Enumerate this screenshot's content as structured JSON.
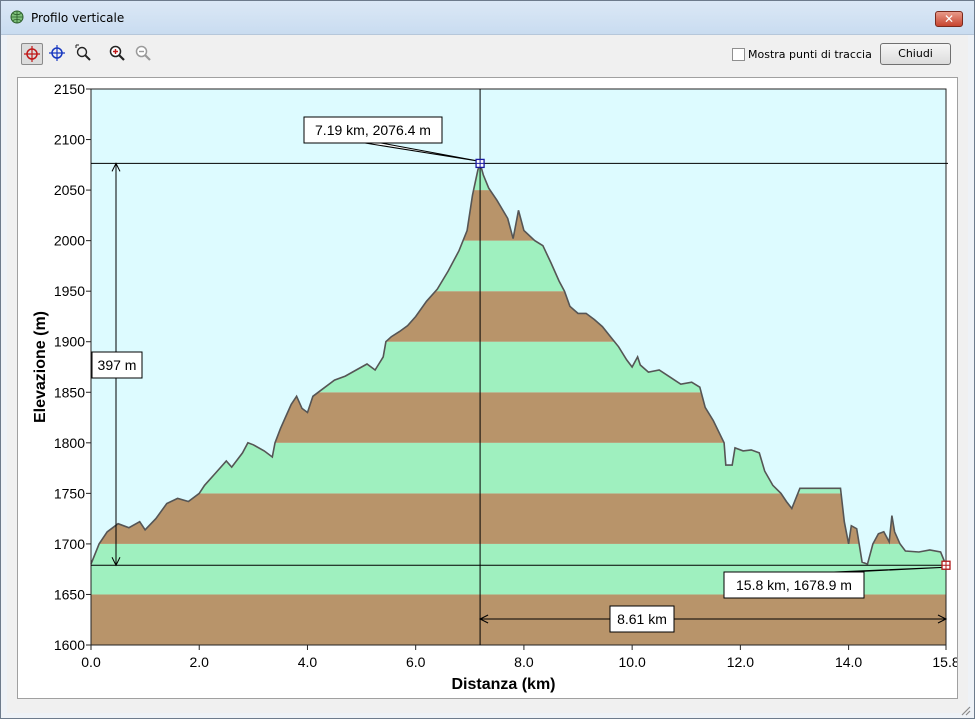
{
  "window": {
    "title": "Profilo verticale",
    "close_glyph": "✕"
  },
  "toolbar": {
    "tools": [
      {
        "name": "crosshair-red-icon"
      },
      {
        "name": "crosshair-blue-icon"
      },
      {
        "name": "zoom-area-icon"
      },
      {
        "name": "zoom-in-icon"
      },
      {
        "name": "zoom-out-icon"
      }
    ],
    "show_points_label": "Mostra punti di traccia",
    "show_points_checked": false,
    "close_label": "Chiudi"
  },
  "chart_data": {
    "type": "area",
    "xlabel": "Distanza  (km)",
    "ylabel": "Elevazione (m)",
    "xlim": [
      0,
      15.8
    ],
    "ylim": [
      1600,
      2150
    ],
    "xticks": [
      "0.0",
      "2.0",
      "4.0",
      "6.0",
      "8.0",
      "10.0",
      "12.0",
      "14.0",
      "15.8"
    ],
    "xtick_values": [
      0,
      2,
      4,
      6,
      8,
      10,
      12,
      14,
      15.8
    ],
    "yticks": [
      "1600",
      "1650",
      "1700",
      "1750",
      "1800",
      "1850",
      "1900",
      "1950",
      "2000",
      "2050",
      "2100",
      "2150"
    ],
    "ytick_values": [
      1600,
      1650,
      1700,
      1750,
      1800,
      1850,
      1900,
      1950,
      2000,
      2050,
      2100,
      2150
    ],
    "band_colors": [
      "#b8946a",
      "#9ff0bf"
    ],
    "sky_color": "#ddfbff",
    "profile_color": "#555555",
    "series": [
      {
        "points": [
          [
            0.0,
            1680
          ],
          [
            0.15,
            1700
          ],
          [
            0.3,
            1712
          ],
          [
            0.5,
            1720
          ],
          [
            0.7,
            1716
          ],
          [
            0.9,
            1722
          ],
          [
            1.0,
            1714
          ],
          [
            1.2,
            1725
          ],
          [
            1.4,
            1740
          ],
          [
            1.6,
            1745
          ],
          [
            1.8,
            1742
          ],
          [
            2.0,
            1750
          ],
          [
            2.1,
            1758
          ],
          [
            2.3,
            1770
          ],
          [
            2.5,
            1782
          ],
          [
            2.6,
            1776
          ],
          [
            2.8,
            1790
          ],
          [
            2.9,
            1800
          ],
          [
            3.0,
            1798
          ],
          [
            3.2,
            1792
          ],
          [
            3.35,
            1786
          ],
          [
            3.4,
            1800
          ],
          [
            3.5,
            1814
          ],
          [
            3.6,
            1826
          ],
          [
            3.7,
            1838
          ],
          [
            3.8,
            1846
          ],
          [
            3.9,
            1834
          ],
          [
            4.0,
            1830
          ],
          [
            4.1,
            1846
          ],
          [
            4.3,
            1854
          ],
          [
            4.5,
            1862
          ],
          [
            4.7,
            1866
          ],
          [
            4.9,
            1872
          ],
          [
            5.1,
            1878
          ],
          [
            5.25,
            1872
          ],
          [
            5.4,
            1885
          ],
          [
            5.45,
            1900
          ],
          [
            5.55,
            1905
          ],
          [
            5.7,
            1910
          ],
          [
            5.85,
            1916
          ],
          [
            6.0,
            1925
          ],
          [
            6.2,
            1940
          ],
          [
            6.4,
            1952
          ],
          [
            6.6,
            1970
          ],
          [
            6.8,
            1990
          ],
          [
            6.95,
            2010
          ],
          [
            7.05,
            2045
          ],
          [
            7.15,
            2070
          ],
          [
            7.19,
            2076.4
          ],
          [
            7.25,
            2065
          ],
          [
            7.35,
            2052
          ],
          [
            7.5,
            2040
          ],
          [
            7.7,
            2022
          ],
          [
            7.8,
            2002
          ],
          [
            7.9,
            2030
          ],
          [
            8.0,
            2010
          ],
          [
            8.2,
            2000
          ],
          [
            8.35,
            1995
          ],
          [
            8.5,
            1978
          ],
          [
            8.65,
            1960
          ],
          [
            8.75,
            1950
          ],
          [
            8.85,
            1935
          ],
          [
            9.0,
            1928
          ],
          [
            9.15,
            1928
          ],
          [
            9.3,
            1922
          ],
          [
            9.45,
            1915
          ],
          [
            9.6,
            1905
          ],
          [
            9.75,
            1895
          ],
          [
            9.9,
            1882
          ],
          [
            10.0,
            1875
          ],
          [
            10.1,
            1885
          ],
          [
            10.15,
            1877
          ],
          [
            10.3,
            1870
          ],
          [
            10.5,
            1872
          ],
          [
            10.7,
            1865
          ],
          [
            10.9,
            1858
          ],
          [
            11.1,
            1860
          ],
          [
            11.25,
            1855
          ],
          [
            11.35,
            1835
          ],
          [
            11.5,
            1822
          ],
          [
            11.7,
            1800
          ],
          [
            11.73,
            1778
          ],
          [
            11.85,
            1778
          ],
          [
            11.9,
            1795
          ],
          [
            12.05,
            1792
          ],
          [
            12.2,
            1793
          ],
          [
            12.35,
            1790
          ],
          [
            12.45,
            1772
          ],
          [
            12.6,
            1758
          ],
          [
            12.75,
            1750
          ],
          [
            12.85,
            1742
          ],
          [
            12.95,
            1735
          ],
          [
            13.1,
            1755
          ],
          [
            13.3,
            1755
          ],
          [
            13.5,
            1755
          ],
          [
            13.7,
            1755
          ],
          [
            13.85,
            1755
          ],
          [
            13.92,
            1722
          ],
          [
            14.0,
            1700
          ],
          [
            14.05,
            1718
          ],
          [
            14.15,
            1715
          ],
          [
            14.25,
            1682
          ],
          [
            14.35,
            1680
          ],
          [
            14.45,
            1700
          ],
          [
            14.55,
            1710
          ],
          [
            14.65,
            1712
          ],
          [
            14.75,
            1702
          ],
          [
            14.8,
            1728
          ],
          [
            14.85,
            1712
          ],
          [
            14.95,
            1700
          ],
          [
            15.05,
            1693
          ],
          [
            15.3,
            1692
          ],
          [
            15.5,
            1694
          ],
          [
            15.7,
            1692
          ],
          [
            15.8,
            1678.9
          ]
        ]
      }
    ],
    "markers": [
      {
        "x": 7.19,
        "y": 2076.4,
        "label": "7.19 km, 2076.4 m",
        "color": "#1a1aa0"
      },
      {
        "x": 15.8,
        "y": 1678.9,
        "label": "15.8 km, 1678.9 m",
        "color": "#b01a1a"
      }
    ],
    "annotations": {
      "elevation_diff": "397 m",
      "distance_diff": "8.61 km"
    }
  }
}
